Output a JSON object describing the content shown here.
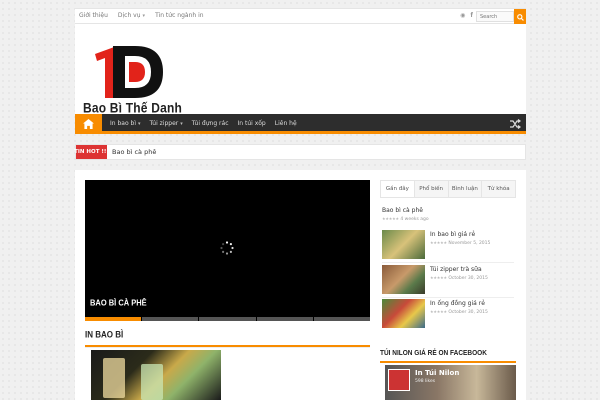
{
  "topbar": {
    "nav": [
      {
        "label": "Giới thiệu",
        "dropdown": false
      },
      {
        "label": "Dịch vụ",
        "dropdown": true
      },
      {
        "label": "Tin tức ngành in",
        "dropdown": false
      }
    ],
    "search_placeholder": "Search",
    "social_icons": [
      "rss-icon",
      "facebook-icon"
    ]
  },
  "header": {
    "logo_text": "Bao Bì Thế Danh"
  },
  "mainnav": {
    "items": [
      {
        "label": "In bao bì",
        "dropdown": true
      },
      {
        "label": "Túi zipper",
        "dropdown": true
      },
      {
        "label": "Túi đựng rác",
        "dropdown": false
      },
      {
        "label": "In túi xốp",
        "dropdown": false
      },
      {
        "label": "Liên hệ",
        "dropdown": false
      }
    ]
  },
  "ticker": {
    "label": "TIN HOT !!!",
    "text": "Bao bì cà phê"
  },
  "slider": {
    "caption": "BAO BÌ CÀ PHÊ",
    "active_slide": 1,
    "slide_count": 5
  },
  "section": {
    "title": "IN BAO BÌ"
  },
  "sidebar": {
    "tabs": [
      "Gần đây",
      "Phổ biến",
      "Bình luận",
      "Từ khóa"
    ],
    "first_post": {
      "title": "Bao bì cà phê",
      "meta": "4 weeks ago"
    },
    "posts": [
      {
        "title": "In bao bì giá rẻ",
        "meta": "November 5, 2015"
      },
      {
        "title": "Túi zipper trà sữa",
        "meta": "October 30, 2015"
      },
      {
        "title": "In ống đồng giá rẻ",
        "meta": "October 30, 2015"
      }
    ],
    "facebook_title": "TÚI NILON GIÁ RẺ ON FACEBOOK",
    "facebook_page": "In Túi Nilon",
    "facebook_likes": "598 likes"
  },
  "colors": {
    "accent": "#f88c00",
    "nav_bg": "#2d2d2d",
    "ticker_red": "#dd3333",
    "logo_red": "#e2231a"
  }
}
